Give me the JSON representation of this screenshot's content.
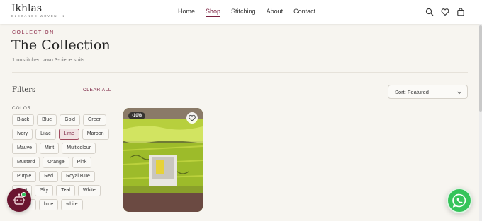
{
  "brand": {
    "name": "Ikhlas",
    "tagline": "ELEGANCE WOVEN IN"
  },
  "nav": {
    "items": [
      "Home",
      "Shop",
      "Stitching",
      "About",
      "Contact"
    ],
    "active": "Shop"
  },
  "header_icons": [
    "search-icon",
    "heart-icon",
    "bag-icon"
  ],
  "collection": {
    "eyebrow": "COLLECTION",
    "title": "The Collection",
    "subtitle": "1 unstitched lawn 3-piece suits"
  },
  "filters": {
    "label": "Filters",
    "clear_all": "CLEAR ALL",
    "color_label": "COLOR",
    "colors": [
      [
        "Black",
        "Blue",
        "Gold",
        "Green"
      ],
      [
        "Ivory",
        "Lilac",
        "Lime",
        "Maroon"
      ],
      [
        "Mauve",
        "Mint",
        "Multicolour"
      ],
      [
        "Mustard",
        "Orange",
        "Pink"
      ],
      [
        "Purple",
        "Red",
        "Royal Blue"
      ],
      [
        "Rust",
        "Sky",
        "Teal",
        "White"
      ],
      [
        "Yellow",
        "blue",
        "white"
      ]
    ],
    "selected": "Lime"
  },
  "sort": {
    "label": "Sort: Featured"
  },
  "product": {
    "discount": "-10%"
  },
  "colors": {
    "accent": "#7a2040",
    "chatbot": "#6a1530",
    "whatsapp": "#35c45a",
    "background": "#f7f5f0"
  }
}
